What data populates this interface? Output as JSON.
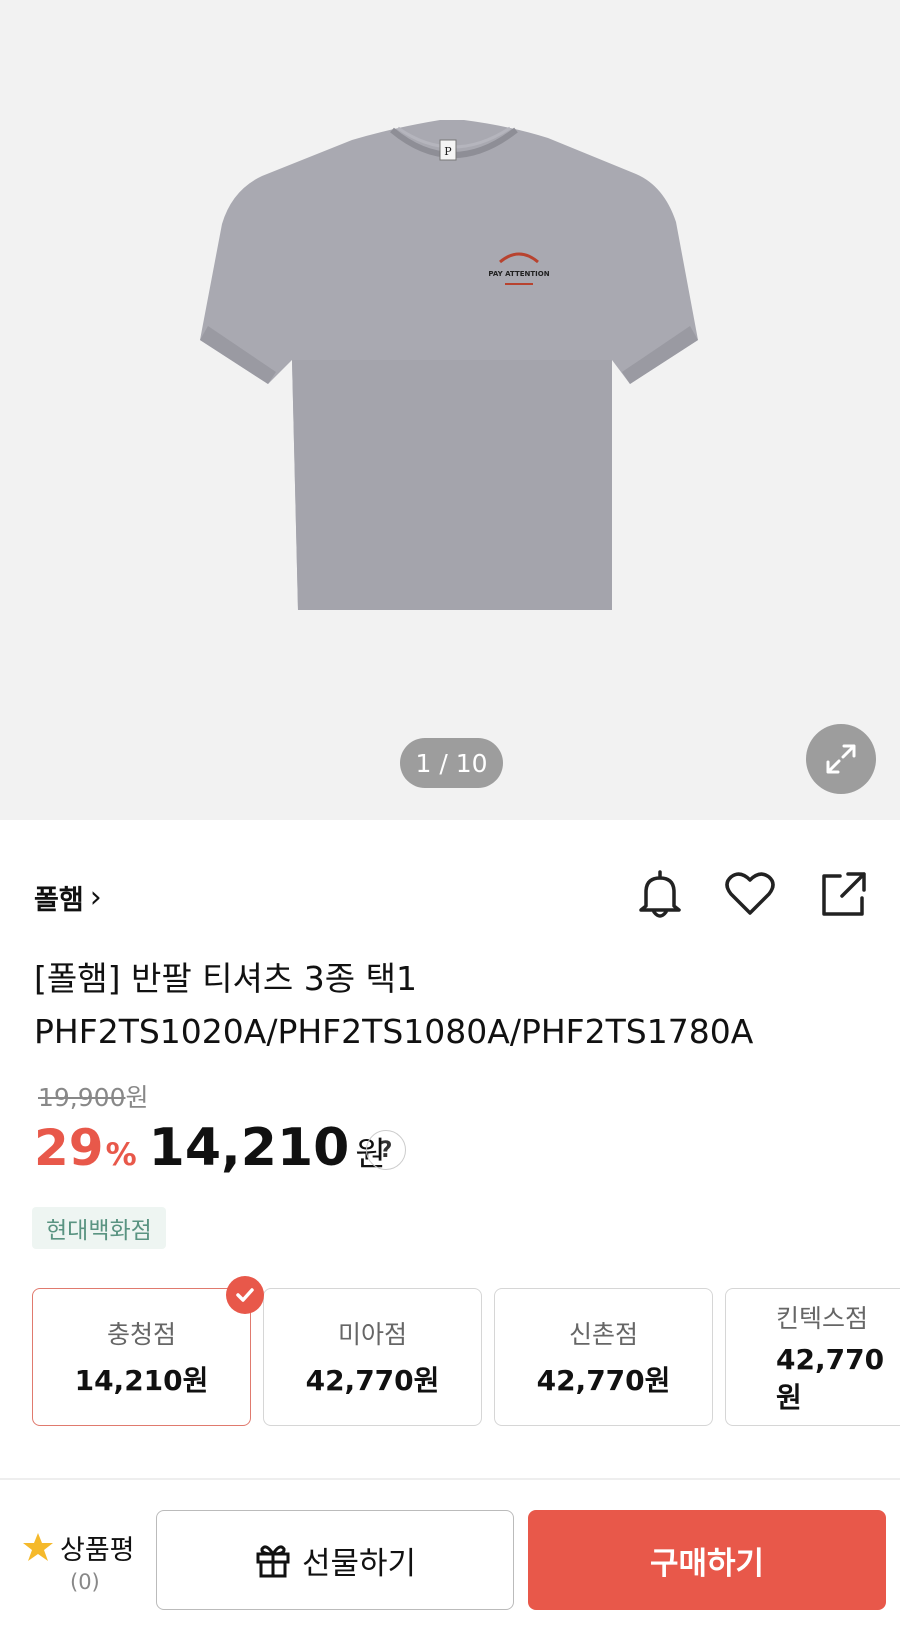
{
  "gallery": {
    "pager": "1 / 10",
    "logo_tag": "P",
    "print_text": "PAY ATTENTION"
  },
  "product": {
    "brand": "폴햄",
    "brand_chevron": "›",
    "title": "[폴햄] 반팔 티셔츠 3종 택1 PHF2TS1020A/PHF2TS1080A/PHF2TS1780A",
    "original_price": "19,900",
    "original_price_unit": "원",
    "discount": "29",
    "discount_unit": "%",
    "sale_price": "14,210",
    "sale_unit": "원",
    "help": "?",
    "store_badge": "현대백화점"
  },
  "stores": [
    {
      "name": "충청점",
      "price": "14,210원",
      "selected": true
    },
    {
      "name": "미아점",
      "price": "42,770원",
      "selected": false
    },
    {
      "name": "신촌점",
      "price": "42,770원",
      "selected": false
    },
    {
      "name": "킨텍스점",
      "price": "42,770원",
      "selected": false
    }
  ],
  "bottom_bar": {
    "review_label": "상품평",
    "review_count": "(0)",
    "gift_label": "선물하기",
    "buy_label": "구매하기"
  },
  "icons": [
    "expand-icon",
    "bell-icon",
    "heart-icon",
    "share-icon",
    "check-icon",
    "star-icon",
    "gift-icon"
  ],
  "colors": {
    "accent": "#e8584a",
    "badge_bg": "#eef5f2",
    "badge_text": "#5a9482",
    "shirt": "#a9a9b1"
  }
}
